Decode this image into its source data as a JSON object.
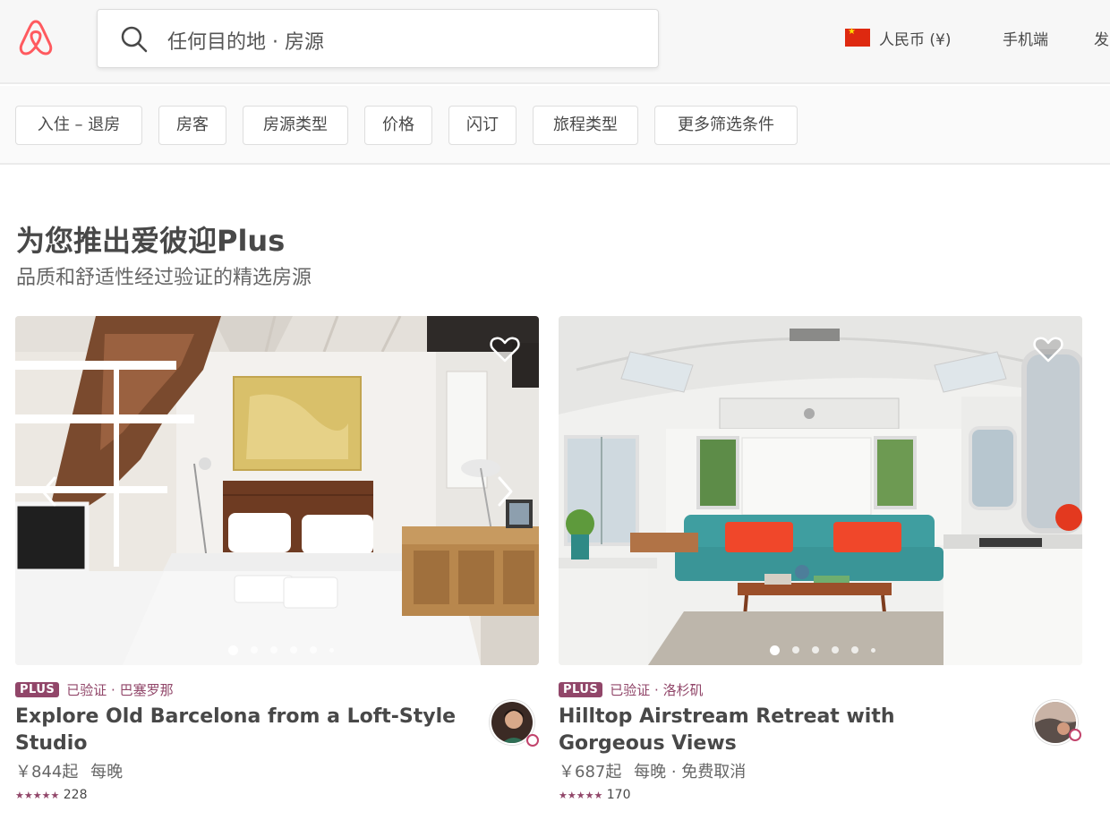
{
  "header": {
    "search_text": "任何目的地 · 房源",
    "currency": "人民币 (¥)",
    "mobile": "手机端",
    "more": "发"
  },
  "filters": [
    "入住 – 退房",
    "房客",
    "房源类型",
    "价格",
    "闪订",
    "旅程类型",
    "更多筛选条件"
  ],
  "section": {
    "title": "为您推出爱彼迎Plus",
    "subtitle": "品质和舒适性经过验证的精选房源"
  },
  "listings": [
    {
      "badge": "PLUS",
      "verified": "已验证 · 巴塞罗那",
      "title": "Explore Old Barcelona from a Loft-Style Studio",
      "price": "￥844起",
      "price_unit": "每晚",
      "extra": "",
      "stars": "★★★★★",
      "reviews": "228"
    },
    {
      "badge": "PLUS",
      "verified": "已验证 · 洛杉矶",
      "title": "Hilltop Airstream Retreat with Gorgeous Views",
      "price": "￥687起",
      "price_unit": "每晚",
      "extra": "· 免费取消",
      "stars": "★★★★★",
      "reviews": "170"
    }
  ],
  "colors": {
    "brand": "#ff5a5f",
    "plus": "#914669"
  },
  "icons": {
    "logo": "airbnb-belo-icon",
    "search": "search-icon",
    "flag": "china-flag-icon",
    "save": "heart-icon",
    "prev": "chevron-left-icon",
    "next": "chevron-right-icon"
  }
}
